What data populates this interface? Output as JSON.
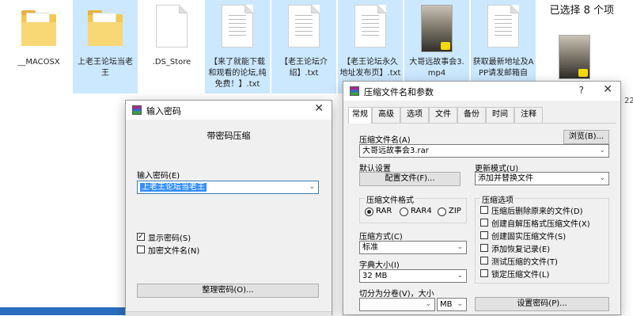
{
  "explorer": {
    "selection_status": "已选择 8 个项",
    "files": [
      {
        "name": "__MACOSX",
        "type": "folder",
        "selected": false
      },
      {
        "name": "上老王论坛当老王",
        "type": "folder",
        "selected": true
      },
      {
        "name": ".DS_Store",
        "type": "file",
        "selected": false
      },
      {
        "name": "【来了就能下载和观看的论坛,纯免费！】.txt",
        "type": "txt",
        "selected": true
      },
      {
        "name": "【老王论坛介绍】.txt",
        "type": "txt",
        "selected": true
      },
      {
        "name": "【老王论坛永久地址发布页】.txt",
        "type": "txt",
        "selected": true
      },
      {
        "name": "大哥远故事会3.mp4",
        "type": "video",
        "selected": true
      },
      {
        "name": "获取最新地址及APP请发邮箱自",
        "type": "txt",
        "selected": true
      }
    ],
    "partial_text_right": "22"
  },
  "password_dialog": {
    "title": "输入密码",
    "close_glyph": "✕",
    "subtitle": "带密码压缩",
    "password_label": "输入密码(E)",
    "password_value": "上老王论坛当老王",
    "show_password_label": "显示密码(S)",
    "show_password_checked": true,
    "encrypt_names_label": "加密文件名(N)",
    "encrypt_names_checked": false,
    "organize_button": "整理密码(O)..."
  },
  "archive_dialog": {
    "title": "压缩文件名和参数",
    "help_glyph": "?",
    "close_glyph": "✕",
    "tabs": [
      "常规",
      "高级",
      "选项",
      "文件",
      "备份",
      "时间",
      "注释"
    ],
    "active_tab": 0,
    "archive_name_label": "压缩文件名(A)",
    "browse_button": "浏览(B)...",
    "archive_name_value": "大哥远故事会3.rar",
    "default_settings_label": "默认设置",
    "profiles_button": "配置文件(F)...",
    "update_mode_label": "更新模式(U)",
    "update_mode_value": "添加并替换文件",
    "format_group_title": "压缩文件格式",
    "formats": [
      "RAR",
      "RAR4",
      "ZIP"
    ],
    "selected_format": 0,
    "options_group_title": "压缩选项",
    "options": [
      "压缩后删除原来的文件(D)",
      "创建自解压格式压缩文件(X)",
      "创建固实压缩文件(S)",
      "添加恢复记录(E)",
      "测试压缩的文件(T)",
      "锁定压缩文件(L)"
    ],
    "method_label": "压缩方式(C)",
    "method_value": "标准",
    "dict_label": "字典大小(I)",
    "dict_value": "32 MB",
    "split_label": "切分为分卷(V)，大小",
    "split_value": "",
    "split_unit": "MB",
    "set_password_button": "设置密码(P)..."
  }
}
